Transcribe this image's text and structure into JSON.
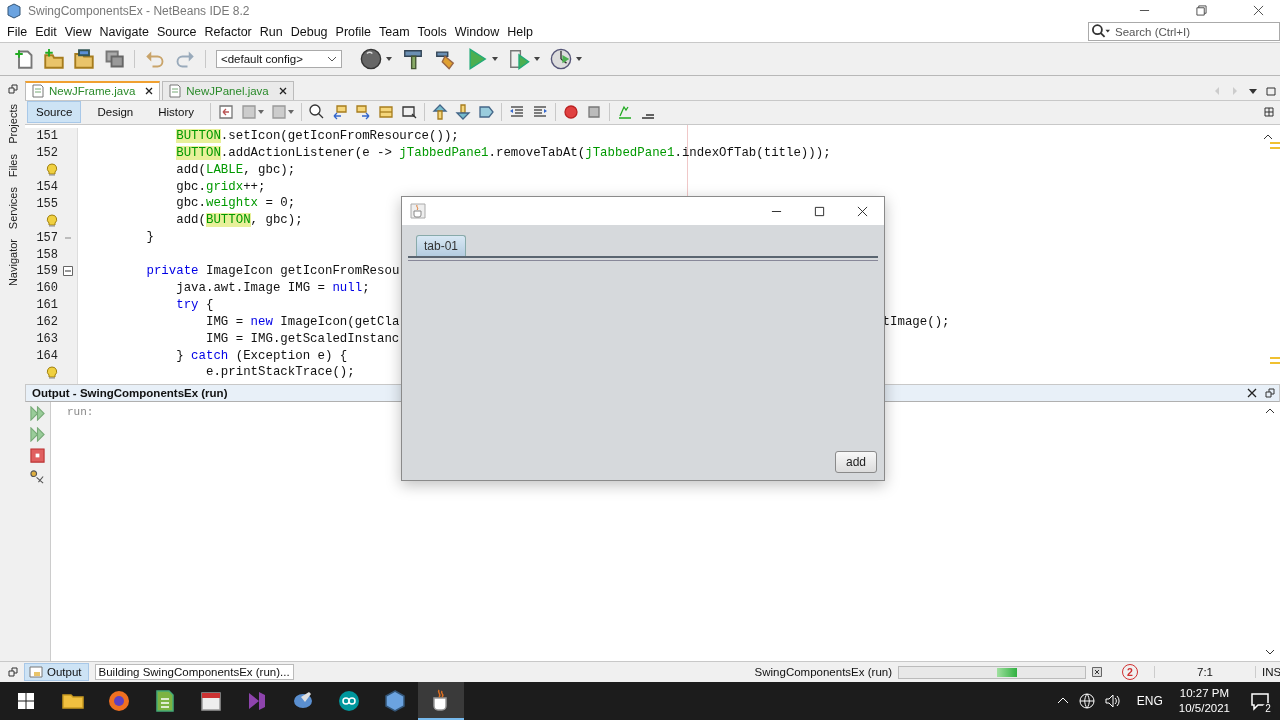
{
  "window": {
    "title": "SwingComponentsEx - NetBeans IDE 8.2"
  },
  "menu": [
    "File",
    "Edit",
    "View",
    "Navigate",
    "Source",
    "Refactor",
    "Run",
    "Debug",
    "Profile",
    "Team",
    "Tools",
    "Window",
    "Help"
  ],
  "search": {
    "placeholder": "Search (Ctrl+I)"
  },
  "toolbar": {
    "config": "<default config>"
  },
  "side_tabs": [
    {
      "label": "Projects"
    },
    {
      "label": "Files"
    },
    {
      "label": "Services"
    },
    {
      "label": "Navigator"
    }
  ],
  "editor_tabs": [
    {
      "label": "NewJFrame.java",
      "selected": true
    },
    {
      "label": "NewJPanel.java",
      "selected": false
    }
  ],
  "view_tabs": [
    {
      "label": "Source",
      "selected": true
    },
    {
      "label": "Design",
      "selected": false
    },
    {
      "label": "History",
      "selected": false
    }
  ],
  "code_lines": [
    {
      "kind": "numbered",
      "number": "151",
      "block_end": false,
      "collapsible": false,
      "segments": [
        {
          "kind": "marked",
          "text": "            BUTTON"
        },
        {
          "kind": "plain",
          "text": ".setIcon(getIconFromResource());"
        }
      ]
    },
    {
      "kind": "numbered",
      "number": "152",
      "block_end": false,
      "collapsible": false,
      "segments": [
        {
          "kind": "marked",
          "text": "            BUTTON"
        },
        {
          "kind": "plain",
          "text": ".addActionListener(e -> "
        },
        {
          "kind": "field",
          "text": "jTabbedPane1"
        },
        {
          "kind": "plain",
          "text": ".removeTabAt("
        },
        {
          "kind": "field",
          "text": "jTabbedPane1"
        },
        {
          "kind": "plain",
          "text": ".indexOfTab(title)));"
        }
      ]
    },
    {
      "kind": "hint",
      "block_end": false,
      "collapsible": false,
      "segments": [
        {
          "kind": "plain",
          "text": "            add("
        },
        {
          "kind": "field",
          "text": "LABLE"
        },
        {
          "kind": "plain",
          "text": ", gbc);"
        }
      ]
    },
    {
      "kind": "numbered",
      "number": "154",
      "block_end": false,
      "collapsible": false,
      "segments": [
        {
          "kind": "plain",
          "text": "            gbc."
        },
        {
          "kind": "field",
          "text": "gridx"
        },
        {
          "kind": "plain",
          "text": "++;"
        }
      ]
    },
    {
      "kind": "numbered",
      "number": "155",
      "block_end": false,
      "collapsible": false,
      "segments": [
        {
          "kind": "plain",
          "text": "            gbc."
        },
        {
          "kind": "field",
          "text": "weightx"
        },
        {
          "kind": "plain",
          "text": " = 0;"
        }
      ]
    },
    {
      "kind": "hint",
      "block_end": false,
      "collapsible": false,
      "segments": [
        {
          "kind": "plain",
          "text": "            add("
        },
        {
          "kind": "marked",
          "text": "BUTTON"
        },
        {
          "kind": "plain",
          "text": ", gbc);"
        }
      ]
    },
    {
      "kind": "numbered",
      "number": "157",
      "block_end": true,
      "collapsible": false,
      "segments": [
        {
          "kind": "plain",
          "text": "        }"
        }
      ]
    },
    {
      "kind": "numbered",
      "number": "158",
      "block_end": false,
      "collapsible": false
    },
    {
      "kind": "numbered",
      "number": "159",
      "block_end": false,
      "collapsible": true,
      "segments": [
        {
          "kind": "keyword",
          "text": "        private"
        },
        {
          "kind": "plain",
          "text": " ImageIcon getIconFromResou"
        }
      ]
    },
    {
      "kind": "numbered",
      "number": "160",
      "block_end": false,
      "collapsible": false,
      "segments": [
        {
          "kind": "plain",
          "text": "            java.awt.Image IMG = "
        },
        {
          "kind": "keyword",
          "text": "null"
        },
        {
          "kind": "plain",
          "text": ";"
        }
      ]
    },
    {
      "kind": "numbered",
      "number": "161",
      "block_end": false,
      "collapsible": false,
      "segments": [
        {
          "kind": "keyword",
          "text": "            try"
        },
        {
          "kind": "plain",
          "text": " {"
        }
      ]
    },
    {
      "kind": "numbered",
      "number": "162",
      "block_end": false,
      "collapsible": false,
      "tail": "tImage();",
      "segments": [
        {
          "kind": "plain",
          "text": "                IMG = "
        },
        {
          "kind": "keyword",
          "text": "new"
        },
        {
          "kind": "plain",
          "text": " ImageIcon(getCla"
        }
      ]
    },
    {
      "kind": "numbered",
      "number": "163",
      "block_end": false,
      "collapsible": false,
      "segments": [
        {
          "kind": "plain",
          "text": "                IMG = IMG.getScaledInstanc"
        }
      ]
    },
    {
      "kind": "numbered",
      "number": "164",
      "block_end": false,
      "collapsible": false,
      "segments": [
        {
          "kind": "plain",
          "text": "            } "
        },
        {
          "kind": "keyword",
          "text": "catch"
        },
        {
          "kind": "plain",
          "text": " (Exception e) {"
        }
      ]
    },
    {
      "kind": "hint",
      "block_end": false,
      "collapsible": false,
      "segments": [
        {
          "kind": "plain",
          "text": "                e.printStackTrace();"
        }
      ]
    }
  ],
  "output": {
    "title": "Output - SwingComponentsEx (run)",
    "lines": [
      "run:"
    ]
  },
  "status_bar": {
    "tabs": [
      {
        "label": "Output",
        "selected": true
      }
    ],
    "task": "Building SwingComponentsEx (run)...",
    "process": "SwingComponentsEx (run)",
    "notifications": "2",
    "position": "7:1",
    "mode": "INS"
  },
  "dialog": {
    "tabs": [
      {
        "label": "tab-01",
        "selected": true
      }
    ],
    "button": "add"
  },
  "taskbar": {
    "apps": [
      {
        "kind": "folder",
        "active": false
      },
      {
        "kind": "browser",
        "active": false
      },
      {
        "kind": "sheet",
        "active": false
      },
      {
        "kind": "calendar",
        "active": false
      },
      {
        "kind": "studio",
        "active": false
      },
      {
        "kind": "paint",
        "active": false
      },
      {
        "kind": "infinity",
        "active": false
      },
      {
        "kind": "cube",
        "active": false
      },
      {
        "kind": "java",
        "active": true
      }
    ],
    "language": "ENG",
    "time": "10:27 PM",
    "date": "10/5/2021",
    "notifications": "2"
  }
}
